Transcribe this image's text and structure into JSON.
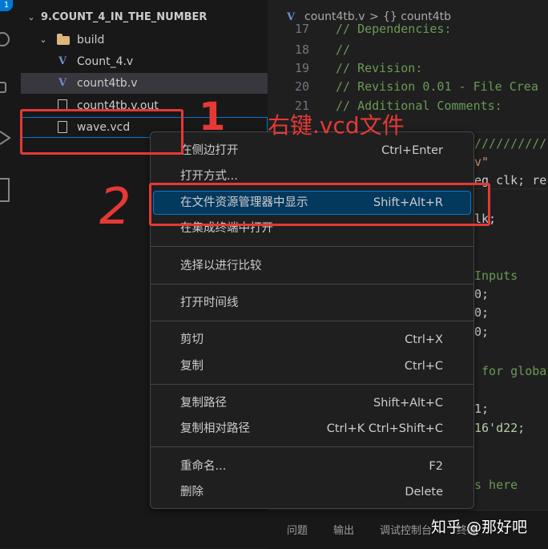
{
  "activity_bar": {
    "badge": "1"
  },
  "explorer": {
    "root": "9.COUNT_4_IN_THE_NUMBER",
    "items": [
      {
        "label": "build",
        "type": "folder"
      },
      {
        "label": "Count_4.v",
        "type": "verilog"
      },
      {
        "label": "count4tb.v",
        "type": "verilog"
      },
      {
        "label": "count4tb.v.out",
        "type": "file"
      },
      {
        "label": "wave.vcd",
        "type": "file"
      }
    ]
  },
  "editor": {
    "tab_label": "count4tb.v",
    "breadcrumb_sep": ">",
    "breadcrumb_symbol": "{} count4tb",
    "lines": [
      {
        "num": "17",
        "text": "// Dependencies:"
      },
      {
        "num": "18",
        "text": "//"
      },
      {
        "num": "19",
        "text": "// Revision:"
      },
      {
        "num": "20",
        "text": "// Revision 0.01 - File Crea"
      },
      {
        "num": "21",
        "text": "// Additional Comments:"
      }
    ],
    "fragments": [
      {
        "text": "//////////",
        "color": "#6a9955"
      },
      {
        "text": "v\"",
        "color": "#ce9178"
      },
      {
        "text": "eg clk; re",
        "color": "#cccccc"
      },
      {
        "text": "lk;",
        "color": "#cccccc"
      },
      {
        "text": "Inputs",
        "color": "#6a9955"
      },
      {
        "text": "0;",
        "color": "#cccccc"
      },
      {
        "text": "0;",
        "color": "#cccccc"
      },
      {
        "text": "0;",
        "color": "#cccccc"
      },
      {
        "text": " for globa",
        "color": "#6a9955"
      },
      {
        "text": "1;",
        "color": "#cccccc"
      },
      {
        "text": "16'd22;",
        "color": "#b5cea8"
      },
      {
        "text": "s here",
        "color": "#6a9955"
      }
    ]
  },
  "panel": {
    "tabs": [
      "问题",
      "输出",
      "调试控制台",
      "终端"
    ]
  },
  "context_menu": {
    "items": [
      {
        "label": "在侧边打开",
        "shortcut": "Ctrl+Enter"
      },
      {
        "label": "打开方式...",
        "shortcut": ""
      },
      {
        "label": "在文件资源管理器中显示",
        "shortcut": "Shift+Alt+R",
        "highlighted": true
      },
      {
        "label": "在集成终端中打开",
        "shortcut": ""
      },
      {
        "label": "选择以进行比较",
        "shortcut": ""
      },
      {
        "label": "打开时间线",
        "shortcut": ""
      },
      {
        "label": "剪切",
        "shortcut": "Ctrl+X"
      },
      {
        "label": "复制",
        "shortcut": "Ctrl+C"
      },
      {
        "label": "复制路径",
        "shortcut": "Shift+Alt+C"
      },
      {
        "label": "复制相对路径",
        "shortcut": "Ctrl+K Ctrl+Shift+C"
      },
      {
        "label": "重命名...",
        "shortcut": "F2"
      },
      {
        "label": "删除",
        "shortcut": "Delete"
      }
    ]
  },
  "annotations": {
    "step1_number": "1",
    "step1_text": "右键.vcd文件",
    "step2_number": "2",
    "accent_color": "#e53935"
  },
  "watermark": "知乎 @那好吧"
}
